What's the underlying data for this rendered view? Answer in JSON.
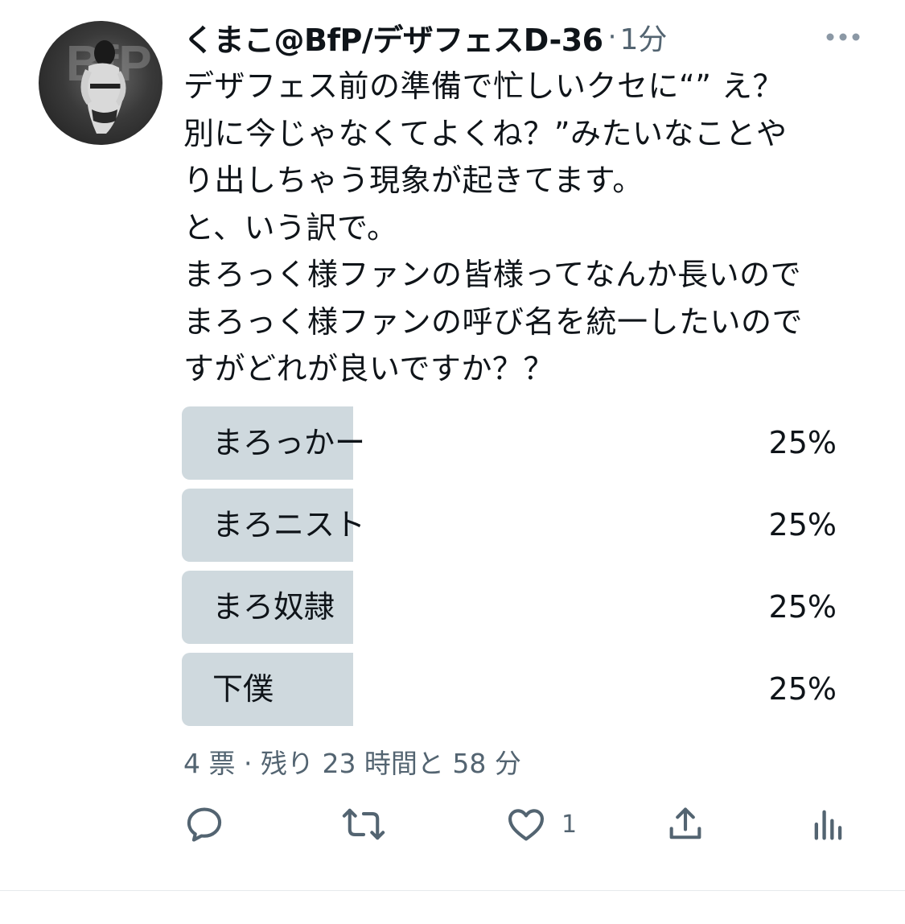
{
  "tweet": {
    "display_name": "くまこ@BfP/デザフェスD-36",
    "separator": "·",
    "timestamp": "1分",
    "avatar_icon": "user-avatar-photo",
    "more_icon": "more-dots-icon",
    "text": "デザフェス前の準備で忙しいクセに“” え？\n別に今じゃなくてよくね？”みたいなことや\nり出しちゃう現象が起きてます。\nと、いう訳で。\nまろっく様ファンの皆様ってなんか長いので\nまろっく様ファンの呼び名を統一したいので\nすがどれが良いですか？？"
  },
  "poll": {
    "options": [
      {
        "label": "まろっかー",
        "percent_text": "25%",
        "fraction": 0.25
      },
      {
        "label": "まろニスト",
        "percent_text": "25%",
        "fraction": 0.25
      },
      {
        "label": "まろ奴隷",
        "percent_text": "25%",
        "fraction": 0.25
      },
      {
        "label": "下僕",
        "percent_text": "25%",
        "fraction": 0.25
      }
    ],
    "meta": "4 票 · 残り 23 時間と 58 分"
  },
  "actions": {
    "reply_icon": "reply-icon",
    "retweet_icon": "retweet-icon",
    "like_icon": "like-heart-icon",
    "like_count": "1",
    "share_icon": "share-icon",
    "analytics_icon": "analytics-icon"
  },
  "colors": {
    "text": "#0f1419",
    "secondary": "#536471",
    "poll_bar": "#cfd9de",
    "icon": "#536471"
  }
}
